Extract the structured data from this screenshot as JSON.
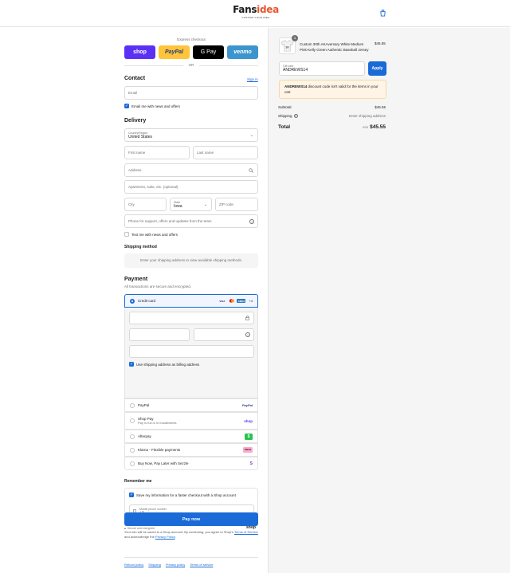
{
  "header": {
    "logo_text_dark": "Fans",
    "logo_text_accent": "idea",
    "logo_tagline": "CUSTOM YOUR IDEA",
    "cart_icon": "shopping-bag-icon"
  },
  "express": {
    "label": "Express checkout",
    "buttons": [
      {
        "label": "shop",
        "color": "#5a31f4",
        "text_color": "#ffffff"
      },
      {
        "label": "PayPal",
        "color": "#ffc439",
        "text_color": "#253b80"
      },
      {
        "label": "G Pay",
        "color": "#000000",
        "text_color": "#ffffff"
      },
      {
        "label": "venmo",
        "color": "#3d95ce",
        "text_color": "#ffffff"
      }
    ],
    "or": "OR"
  },
  "contact": {
    "title": "Contact",
    "sign_in": "Sign in",
    "email_placeholder": "Email",
    "email_news": "Email me with news and offers"
  },
  "delivery": {
    "title": "Delivery",
    "country_label": "Country/Region",
    "country_value": "United States",
    "first_name": "First name",
    "last_name": "Last name",
    "address": "Address",
    "apartment": "Apartment, suite, etc. (optional)",
    "city": "City",
    "state_label": "State",
    "state_value": "Iowa",
    "zip": "ZIP code",
    "phone": "Phone for support, offers and updates from the team",
    "text_news": "Text me with news and offers"
  },
  "shipping": {
    "title": "Shipping method",
    "notice": "Enter your shipping address to view available shipping methods."
  },
  "payment": {
    "title": "Payment",
    "subtitle": "All transactions are secure and encrypted.",
    "credit_card": "Credit card",
    "card_brands": [
      "VISA",
      "MC",
      "AMEX"
    ],
    "more_cards": "+4",
    "billing_same": "Use shipping address as billing address",
    "options": [
      {
        "label": "PayPal",
        "sub": "",
        "badge": "PayPal"
      },
      {
        "label": "Shop Pay",
        "sub": "Pay in full or in installments",
        "badge": "shop"
      },
      {
        "label": "Afterpay",
        "sub": "",
        "badge": "$"
      },
      {
        "label": "Klarna - Flexible payments",
        "sub": "",
        "badge": "Klarna"
      },
      {
        "label": "Buy Now, Pay Later with Sezzle",
        "sub": "",
        "badge": "S"
      }
    ]
  },
  "remember": {
    "title": "Remember me",
    "save_info": "Save my information for a faster checkout with a Shop account",
    "mobile_label": "Mobile phone number",
    "mobile_value": "+1",
    "secure": "Secure and encrypted",
    "shop_logo": "shop"
  },
  "pay_now": "Pay now",
  "disclaimer": {
    "line1": "Your info will be saved to a Shop account. By continuing, you agree to Shop's",
    "tos": "Terms of Service",
    "and": " and acknowledge the ",
    "privacy": "Privacy Policy",
    "end": "."
  },
  "footer": [
    "Refund policy",
    "Shipping",
    "Privacy policy",
    "Terms of service"
  ],
  "summary": {
    "item_qty": "1",
    "item_name": "Custom 30th AKAversary White Medium Pink-Kelly Green Authentic Baseball Jersey",
    "item_price": "$45.55",
    "gift_label": "Gift card",
    "gift_value": "ANDREWS14",
    "apply": "Apply",
    "alert_code": "ANDREWS14",
    "alert_text": " discount code isn't valid for the items in your cart",
    "subtotal_label": "Subtotal",
    "subtotal_value": "$45.55",
    "shipping_label": "Shipping",
    "shipping_value": "Enter shipping address",
    "total_label": "Total",
    "total_currency": "USD",
    "total_value": "$45.55"
  }
}
